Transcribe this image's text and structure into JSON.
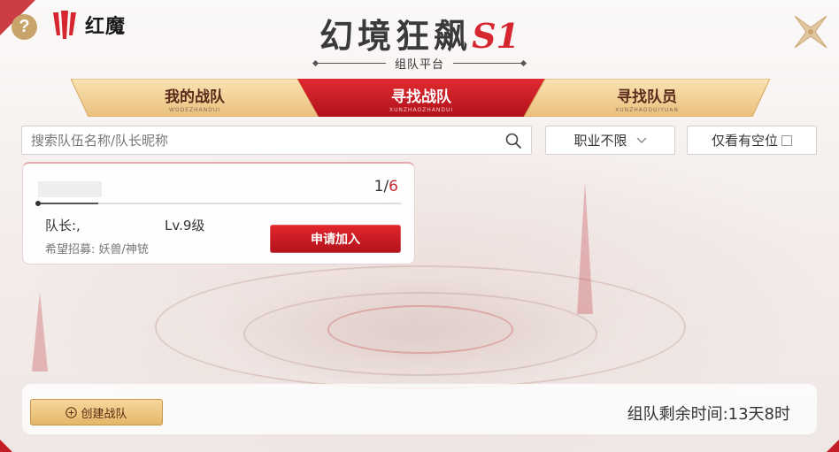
{
  "header": {
    "help_icon": "question-circle-icon",
    "brand": "红魔",
    "title_main": "幻境狂飙",
    "title_accent": "S1",
    "subtitle": "组队平台",
    "close_icon": "close-x-icon"
  },
  "tabs": [
    {
      "label": "我的战队",
      "sub": "WODEZHANDUI",
      "active": false
    },
    {
      "label": "寻找战队",
      "sub": "XUNZHAOZHANDUI",
      "active": true
    },
    {
      "label": "寻找队员",
      "sub": "XUNZHAODUIYUAN",
      "active": false
    }
  ],
  "search": {
    "placeholder": "搜索队伍名称/队长昵称",
    "value": ""
  },
  "profession_filter": {
    "selected": "职业不限"
  },
  "vacancy_filter": {
    "label": "仅看有空位",
    "checked": false
  },
  "teams": [
    {
      "name": "",
      "members_current": "1",
      "members_sep": "/",
      "members_max": "6",
      "fill_fraction": 0.167,
      "leader_label": "队长:,",
      "level": "Lv.9级",
      "recruit": "希望招募: 妖兽/神铳",
      "join_label": "申请加入"
    }
  ],
  "footer": {
    "create_label": "创建战队",
    "timer_text": "组队剩余时间:13天8时"
  },
  "colors": {
    "accent_red": "#d6262f",
    "gold": "#e4b768",
    "background": "#f6f2f0"
  }
}
